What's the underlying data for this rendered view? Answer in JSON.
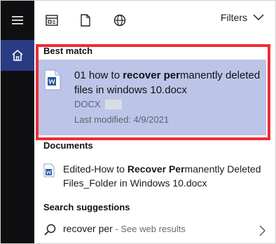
{
  "toolbar": {
    "filters_label": "Filters",
    "icons": [
      "apps-icon",
      "documents-icon",
      "web-icon",
      "menu-icon",
      "home-icon"
    ]
  },
  "best_match": {
    "header": "Best match",
    "title_pre": "01 how to ",
    "title_bold": "recover per",
    "title_post": "manently deleted files in windows 10.docx",
    "type": "DOCX",
    "modified": "Last modified: 4/9/2021"
  },
  "documents": {
    "header": "Documents",
    "item_pre": "Edited-How to ",
    "item_bold": "Recover Per",
    "item_post": "manently Deleted Files_Folder in Windows 10.docx"
  },
  "search_suggestions": {
    "header": "Search suggestions",
    "query": "recover per",
    "suffix": " - See web results"
  },
  "colors": {
    "rail": "#0f0f12",
    "home_active": "#2b3b83",
    "highlight": "#bcc5e8",
    "annotation_border": "#ef2b34",
    "word_blue": "#2b579a"
  }
}
